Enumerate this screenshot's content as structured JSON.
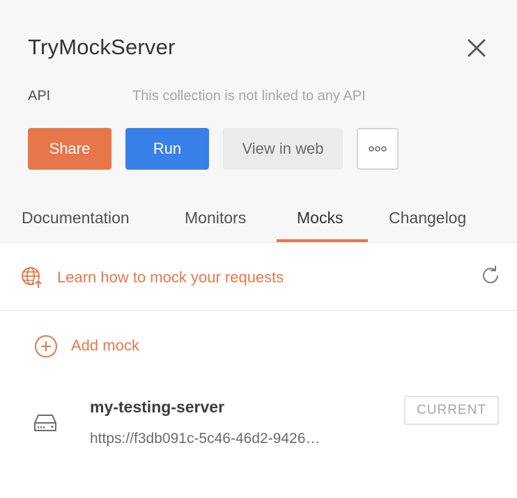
{
  "header": {
    "title": "TryMockServer",
    "api_label": "API",
    "api_value": "This collection is not linked to any API"
  },
  "actions": {
    "share": "Share",
    "run": "Run",
    "view_in_web": "View in web",
    "more_icon": "ellipsis-icon"
  },
  "tabs": [
    {
      "label": "Documentation",
      "active": false
    },
    {
      "label": "Monitors",
      "active": false
    },
    {
      "label": "Mocks",
      "active": true
    },
    {
      "label": "Changelog",
      "active": false
    }
  ],
  "mocks_panel": {
    "learn_link": "Learn how to mock your requests",
    "add_mock": "Add mock",
    "items": [
      {
        "name": "my-testing-server",
        "url": "https://f3db091c-5c46-46d2-9426…",
        "badge": "CURRENT"
      }
    ]
  },
  "colors": {
    "accent": "#e8764b",
    "primary": "#3a80e9",
    "header_bg": "#f7f7f7"
  },
  "icons": [
    "close-icon",
    "globe-icon",
    "refresh-icon",
    "add-circle-icon",
    "server-icon"
  ]
}
